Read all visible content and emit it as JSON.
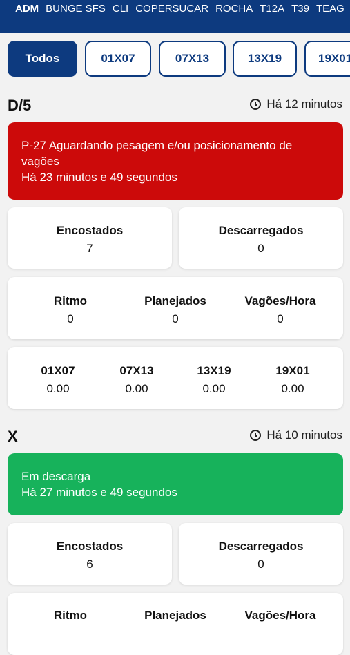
{
  "top_tabs": [
    "ADM",
    "BUNGE SFS",
    "CLI",
    "COPERSUCAR",
    "ROCHA",
    "T12A",
    "T39",
    "TEAG"
  ],
  "filters": [
    "Todos",
    "01X07",
    "07X13",
    "13X19",
    "19X01"
  ],
  "sections": [
    {
      "title": "D/5",
      "updated": "Há 12 minutos",
      "alert": {
        "color": "#cc0a0a",
        "line1": "P-27 Aguardando pesagem e/ou posicionamento de",
        "line2": "vagões",
        "line3": "Há 23 minutos e 49 segundos"
      },
      "encostados_label": "Encostados",
      "encostados": "7",
      "descarregados_label": "Descarregados",
      "descarregados": "0",
      "ritmo_label": "Ritmo",
      "ritmo": "0",
      "planejados_label": "Planejados",
      "planejados": "0",
      "vagoes_hora_label": "Vagões/Hora",
      "vagoes_hora": "0",
      "shifts": [
        {
          "label": "01X07",
          "value": "0.00"
        },
        {
          "label": "07X13",
          "value": "0.00"
        },
        {
          "label": "13X19",
          "value": "0.00"
        },
        {
          "label": "19X01",
          "value": "0.00"
        }
      ]
    },
    {
      "title": "X",
      "updated": "Há 10 minutos",
      "alert": {
        "color": "#17b25b",
        "line1": "Em descarga",
        "line2": "Há 27 minutos e 49 segundos"
      },
      "encostados_label": "Encostados",
      "encostados": "6",
      "descarregados_label": "Descarregados",
      "descarregados": "0",
      "ritmo_label": "Ritmo",
      "planejados_label": "Planejados",
      "vagoes_hora_label": "Vagões/Hora"
    }
  ]
}
